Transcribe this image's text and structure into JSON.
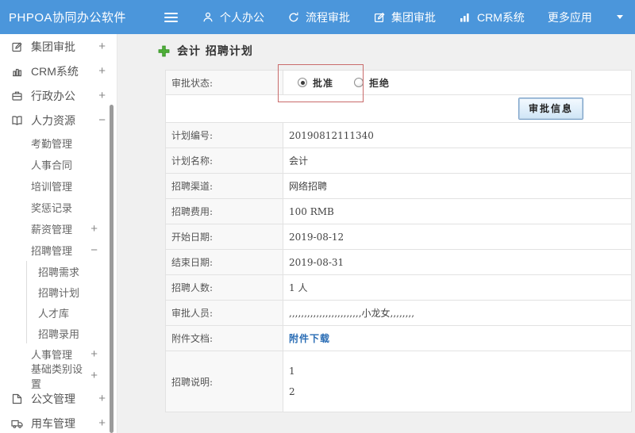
{
  "navbar": {
    "brand": "PHPOA协同办公软件",
    "items": [
      {
        "icon": "user",
        "label": "个人办公"
      },
      {
        "icon": "cycle",
        "label": "流程审批"
      },
      {
        "icon": "edit",
        "label": "集团审批"
      },
      {
        "icon": "bar-chart",
        "label": "CRM系统"
      },
      {
        "icon": "caret-down",
        "label": "更多应用"
      }
    ]
  },
  "sidebar": {
    "items": [
      {
        "icon": "edit-square",
        "label": "集团审批",
        "toggle": "+"
      },
      {
        "icon": "bar-chart",
        "label": "CRM系统",
        "toggle": "+"
      },
      {
        "icon": "briefcase",
        "label": "行政办公",
        "toggle": "+"
      },
      {
        "icon": "open-book",
        "label": "人力资源",
        "toggle": "−",
        "children": [
          {
            "label": "考勤管理"
          },
          {
            "label": "人事合同"
          },
          {
            "label": "培训管理"
          },
          {
            "label": "奖惩记录"
          },
          {
            "label": "薪资管理",
            "toggle": "+"
          },
          {
            "label": "招聘管理",
            "toggle": "−",
            "children": [
              {
                "label": "招聘需求"
              },
              {
                "label": "招聘计划"
              },
              {
                "label": "人才库"
              },
              {
                "label": "招聘录用"
              }
            ]
          },
          {
            "label": "人事管理",
            "toggle": "+"
          },
          {
            "label": "基础类别设置",
            "toggle": "+"
          }
        ]
      },
      {
        "icon": "document",
        "label": "公文管理",
        "toggle": "+"
      },
      {
        "icon": "truck",
        "label": "用车管理",
        "toggle": "+"
      }
    ]
  },
  "main": {
    "page_title": "会计 招聘计划",
    "form": {
      "status_label": "审批状态:",
      "radio_approve": "批准",
      "radio_reject": "拒绝",
      "approve_info_button": "审批信息",
      "rows": [
        {
          "label": "计划编号:",
          "value": "20190812111340"
        },
        {
          "label": "计划名称:",
          "value": "会计"
        },
        {
          "label": "招聘渠道:",
          "value": "网络招聘"
        },
        {
          "label": "招聘费用:",
          "value": "100 RMB"
        },
        {
          "label": "开始日期:",
          "value": "2019-08-12"
        },
        {
          "label": "结束日期:",
          "value": "2019-08-31"
        },
        {
          "label": "招聘人数:",
          "value": "1 人"
        },
        {
          "label": "审批人员:",
          "value": ",,,,,,,,,,,,,,,,,,,,,,,,小龙女,,,,,,,,"
        },
        {
          "label": "附件文档:",
          "value": "附件下载"
        },
        {
          "label": "招聘说明:",
          "lines": [
            "1",
            "2"
          ]
        }
      ]
    }
  },
  "colors": {
    "navbar_blue": "#4b96db",
    "highlight_red": "#c96b6b",
    "link_blue": "#2a6db5",
    "plus_green": "#4fae38"
  }
}
